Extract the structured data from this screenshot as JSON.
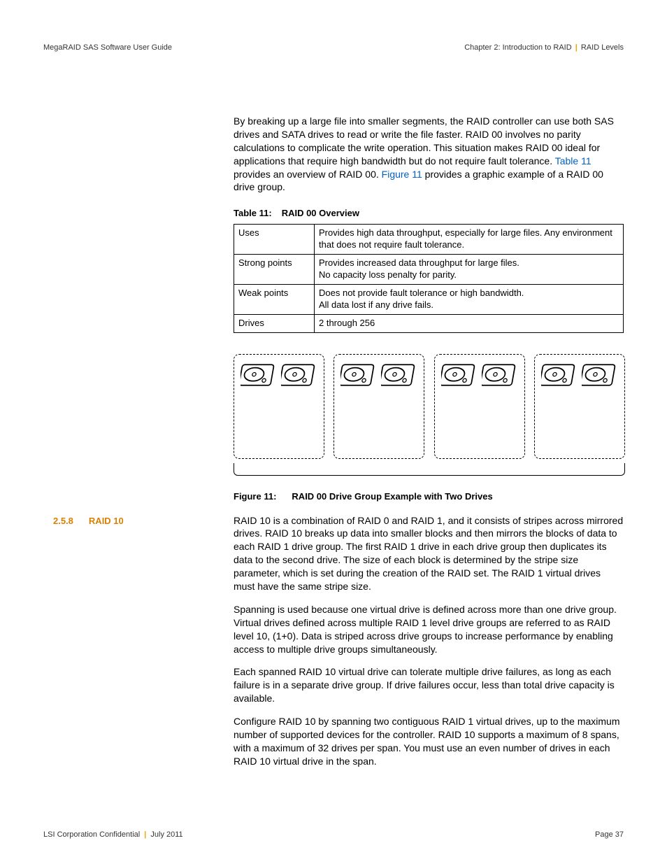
{
  "header": {
    "left": "MegaRAID SAS Software User Guide",
    "right_chapter": "Chapter 2: Introduction to RAID",
    "right_section": "RAID Levels"
  },
  "intro_para": {
    "t1": "By breaking up a large file into smaller segments, the RAID controller can use both SAS drives and SATA drives to read or write the file faster. RAID 00 involves no parity calculations to complicate the write operation. This situation makes RAID 00 ideal for applications that require high bandwidth but do not require fault tolerance. ",
    "link1": "Table 11",
    "t2": " provides an overview of RAID 00. ",
    "link2": "Figure 11",
    "t3": " provides a graphic example of a RAID 00 drive group."
  },
  "table_caption": {
    "num": "Table 11:",
    "title": "RAID 00 Overview"
  },
  "table_rows": [
    {
      "k": "Uses",
      "v": "Provides high data throughput, especially for large files. Any environment that does not require fault tolerance."
    },
    {
      "k": "Strong points",
      "v": "Provides increased data throughput for large files.\nNo capacity loss penalty for parity."
    },
    {
      "k": "Weak points",
      "v": "Does not provide fault tolerance or high bandwidth.\nAll data lost if any drive fails."
    },
    {
      "k": "Drives",
      "v": "2 through 256"
    }
  ],
  "figure_caption": {
    "num": "Figure 11:",
    "title": "RAID 00 Drive Group Example with Two Drives"
  },
  "section": {
    "num": "2.5.8",
    "title": "RAID 10"
  },
  "body_paras": [
    "RAID 10 is a combination of RAID 0 and RAID 1, and it consists of stripes across mirrored drives. RAID 10 breaks up data into smaller blocks and then mirrors the blocks of data to each RAID 1 drive group. The first RAID 1 drive in each drive group then duplicates its data to the second drive. The size of each block is determined by the stripe size parameter, which is set during the creation of the RAID set. The RAID 1 virtual drives must have the same stripe size.",
    "Spanning is used because one virtual drive is defined across more than one drive group. Virtual drives defined across multiple RAID 1 level drive groups are referred to as RAID level 10, (1+0). Data is striped across drive groups to increase performance by enabling access to multiple drive groups simultaneously.",
    "Each spanned RAID 10 virtual drive can tolerate multiple drive failures, as long as each failure is in a separate drive group. If drive failures occur, less than total drive capacity is available.",
    "Configure RAID 10 by spanning two contiguous RAID 1 virtual drives, up to the maximum number of supported devices for the controller. RAID 10 supports a maximum of 8 spans, with a maximum of 32 drives per span. You must use an even number of drives in each RAID 10 virtual drive in the span."
  ],
  "footer": {
    "left_a": "LSI Corporation Confidential",
    "left_b": "July 2011",
    "right": "Page 37"
  }
}
